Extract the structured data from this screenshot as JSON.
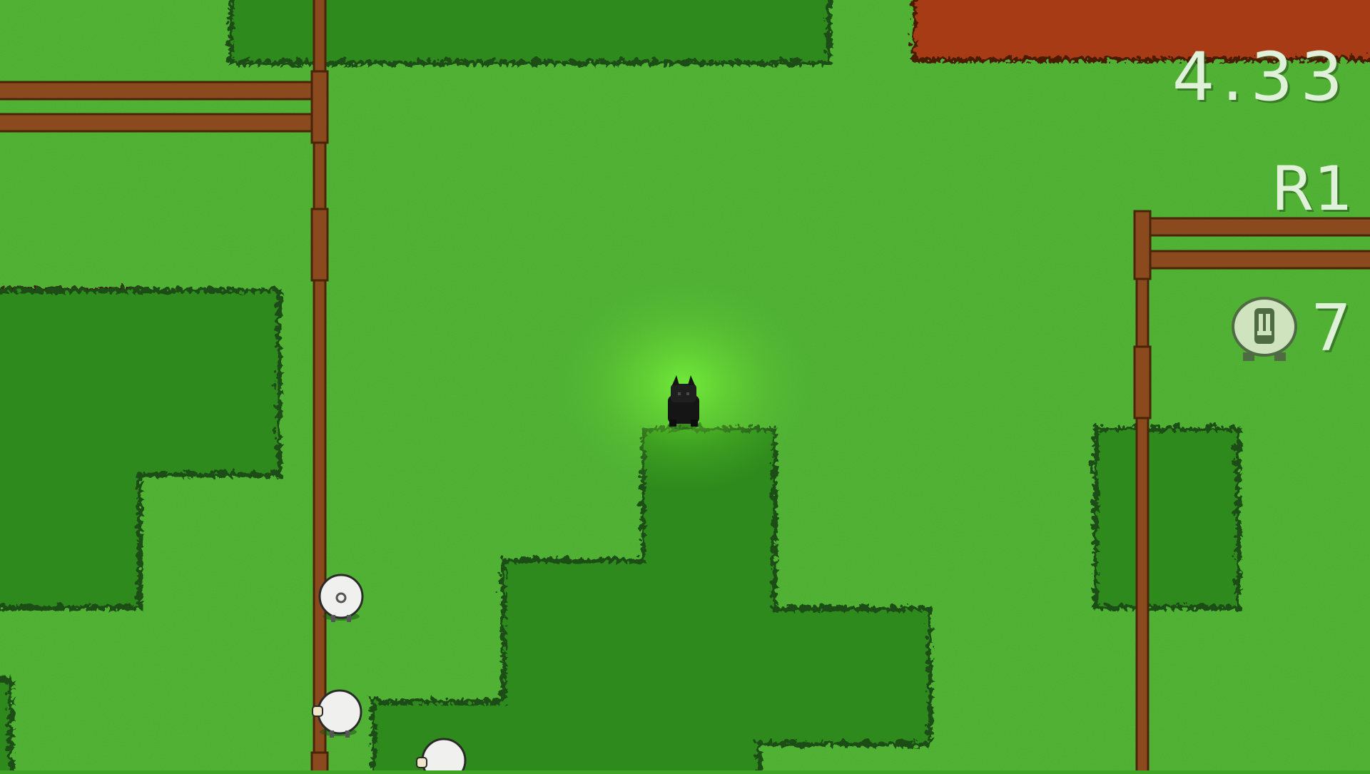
{
  "hud": {
    "timer": "4.33",
    "round": "R1",
    "sheep_icon": "sheep-counter-icon",
    "sheep_count": "7"
  },
  "colors": {
    "grass": "#48ad2a",
    "grass_light": "#5cc93a",
    "hedge": "#2f8a1d",
    "hedge_edge": "#1a4d12",
    "dirt": "#6b3a14",
    "soil_red": "#a63a12",
    "fence": "#8a4a1e",
    "fence_dark": "#4a2408",
    "sheep_wool": "#f0f0ee",
    "hud_text": "#dff1d8"
  },
  "entities": {
    "player": "black-wolf-dog",
    "sheep": "white-sheep"
  }
}
